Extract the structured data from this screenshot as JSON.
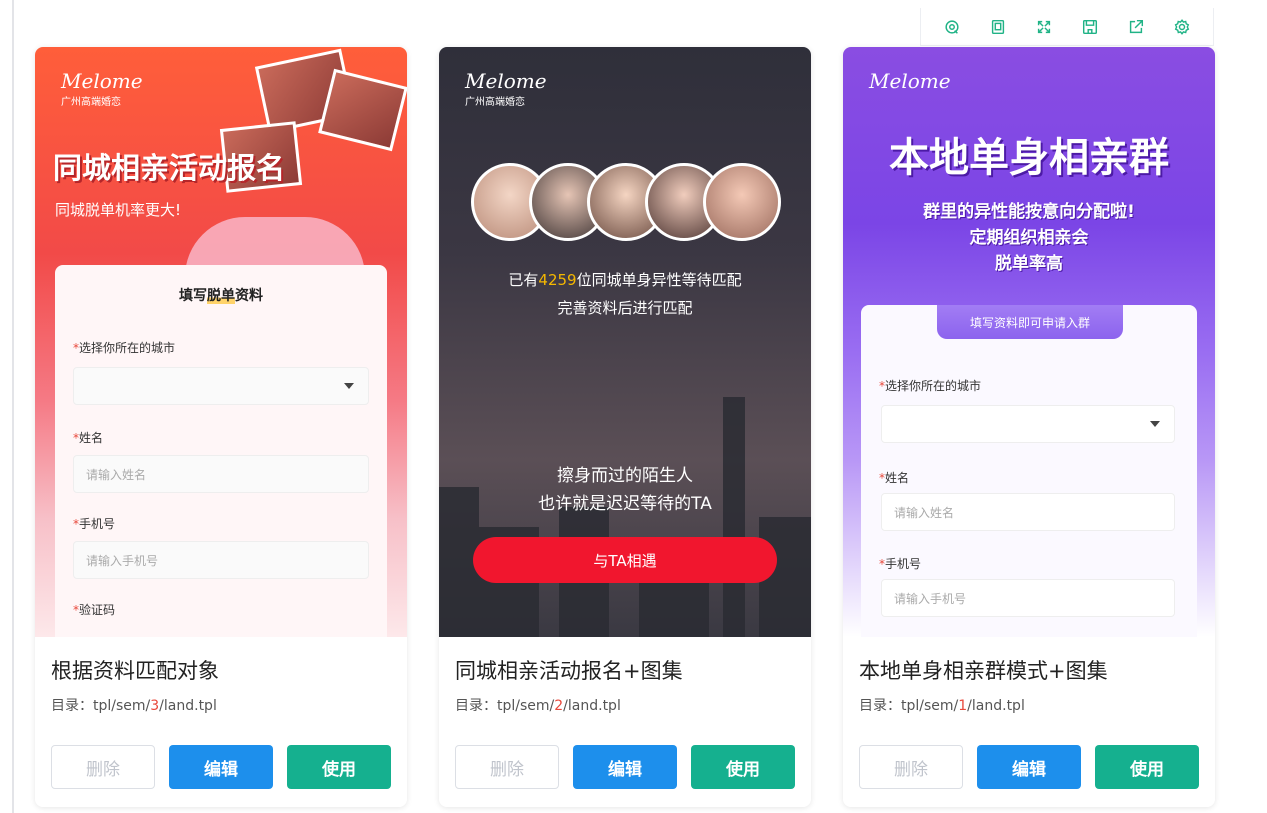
{
  "toolbar": {
    "icons": [
      "refresh-icon",
      "copy-icon",
      "fullscreen-icon",
      "save-icon",
      "export-icon",
      "settings-icon"
    ],
    "accent": "#20b386"
  },
  "cards": [
    {
      "title": "根据资料匹配对象",
      "path_prefix": "目录：tpl/sem/",
      "path_num": "3",
      "path_suffix": "/land.tpl",
      "preview": {
        "logo_script": "Melome",
        "logo_sub": "广州高端婚恋",
        "headline": "同城相亲活动报名",
        "subline": "同城脱单机率更大!",
        "form_title_a": "填写",
        "form_title_hl": "脱单",
        "form_title_b": "资料",
        "field_city": "选择你所在的城市",
        "field_name": "姓名",
        "placeholder_name": "请输入姓名",
        "field_phone": "手机号",
        "placeholder_phone": "请输入手机号",
        "field_code": "验证码"
      },
      "buttons": {
        "delete": "删除",
        "edit": "编辑",
        "use": "使用"
      }
    },
    {
      "title": "同城相亲活动报名+图集",
      "path_prefix": "目录：tpl/sem/",
      "path_num": "2",
      "path_suffix": "/land.tpl",
      "preview": {
        "logo_script": "Melome",
        "logo_sub": "广州高端婚恋",
        "count_prefix": "已有",
        "count": "4259",
        "count_suffix": "位同城单身异性等待匹配",
        "line2": "完善资料后进行匹配",
        "quote1": "擦身而过的陌生人",
        "quote2": "也许就是迟迟等待的TA",
        "cta": "与TA相遇"
      },
      "buttons": {
        "delete": "删除",
        "edit": "编辑",
        "use": "使用"
      }
    },
    {
      "title": "本地单身相亲群模式+图集",
      "path_prefix": "目录：tpl/sem/",
      "path_num": "1",
      "path_suffix": "/land.tpl",
      "preview": {
        "logo_script": "Melome",
        "headline": "本地单身相亲群",
        "sub1": "群里的异性能按意向分配啦!",
        "sub2": "定期组织相亲会",
        "sub3": "脱单率高",
        "form_tab": "填写资料即可申请入群",
        "field_city": "选择你所在的城市",
        "field_name": "姓名",
        "placeholder_name": "请输入姓名",
        "field_phone": "手机号",
        "placeholder_phone": "请输入手机号"
      },
      "buttons": {
        "delete": "删除",
        "edit": "编辑",
        "use": "使用"
      }
    }
  ]
}
